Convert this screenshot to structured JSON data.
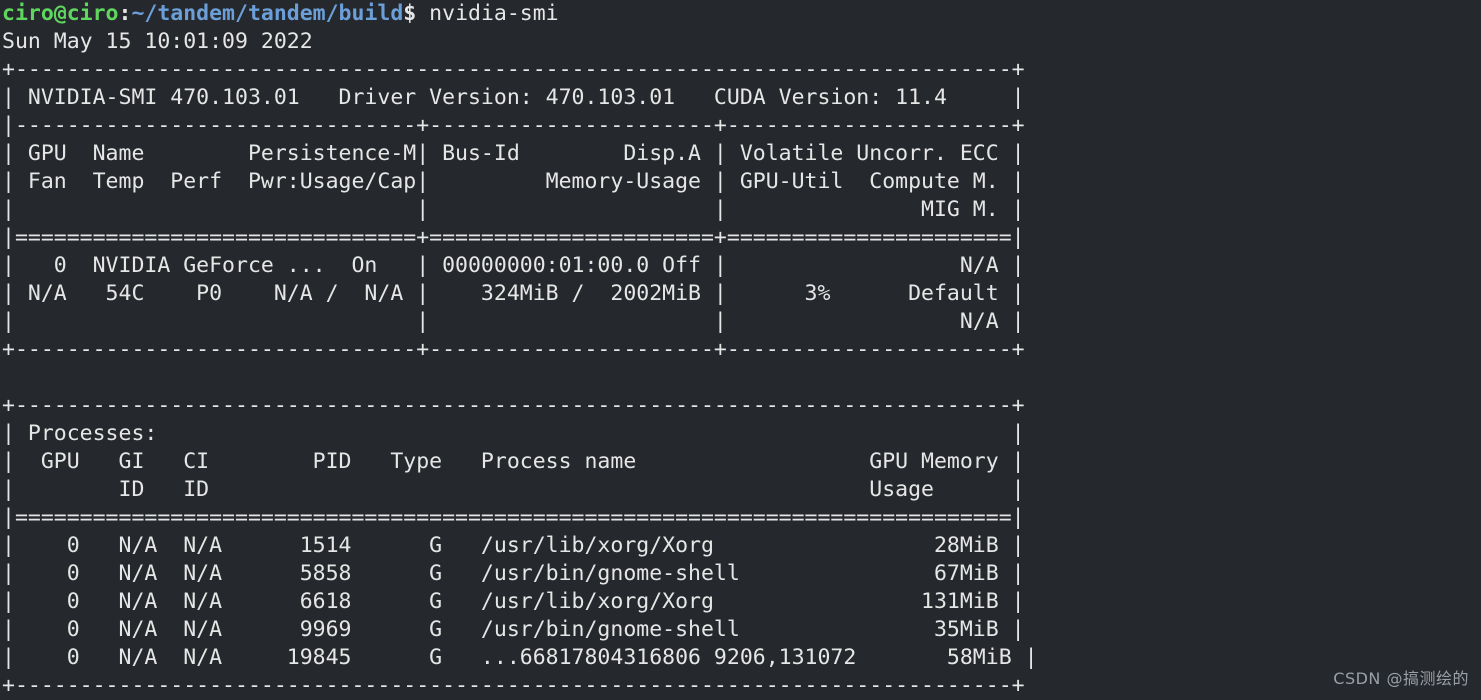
{
  "terminal": {
    "background_color": "#25282c",
    "foreground_color": "#e6e6e6",
    "prompt": {
      "user_host": "ciro@ciro",
      "separator": ":",
      "path": "~/tandem/tandem/build",
      "dollar": "$",
      "command": " nvidia-smi",
      "user_color": "#5fd75f",
      "path_color": "#6c9fd8"
    },
    "timestamp_line": "Sun May 15 10:01:09 2022",
    "gpu_table": {
      "top_border": "+-----------------------------------------------------------------------------+",
      "title_row": "| NVIDIA-SMI 470.103.01   Driver Version: 470.103.01   CUDA Version: 11.4     |",
      "title_fields": {
        "nvidia_smi_version": "470.103.01",
        "driver_version": "470.103.01",
        "cuda_version": "11.4"
      },
      "inner_border": "|-------------------------------+----------------------+----------------------+",
      "header_row_1": "| GPU  Name        Persistence-M| Bus-Id        Disp.A | Volatile Uncorr. ECC |",
      "header_row_2": "| Fan  Temp  Perf  Pwr:Usage/Cap|         Memory-Usage | GPU-Util  Compute M. |",
      "header_row_3": "|                               |                      |               MIG M. |",
      "header_separator": "|===============================+======================+======================|",
      "data_row_1": "|   0  NVIDIA GeForce ...  On   | 00000000:01:00.0 Off |                  N/A |",
      "data_row_2": "| N/A   54C    P0    N/A /  N/A |    324MiB /  2002MiB |      3%      Default |",
      "data_row_3": "|                               |                      |                  N/A |",
      "bottom_border": "+-------------------------------+----------------------+----------------------+",
      "gpu_values": {
        "gpu_index": "0",
        "name": "NVIDIA GeForce ...",
        "persistence_m": "On",
        "bus_id": "00000000:01:00.0",
        "disp_a": "Off",
        "ecc": "N/A",
        "fan": "N/A",
        "temp": "54C",
        "perf": "P0",
        "pwr_usage_cap": "N/A /  N/A",
        "memory_used": "324MiB",
        "memory_total": "2002MiB",
        "gpu_util": "3%",
        "compute_m": "Default",
        "mig_m": "N/A"
      }
    },
    "blank_line": "",
    "processes_table": {
      "top_border": "+-----------------------------------------------------------------------------+",
      "title_row": "| Processes:                                                                  |",
      "title": "Processes:",
      "header_row_1": "|  GPU   GI   CI        PID   Type   Process name                  GPU Memory |",
      "header_row_2": "|        ID   ID                                                   Usage      |",
      "header_separator": "|=============================================================================|",
      "columns": [
        "GPU",
        "GI ID",
        "CI ID",
        "PID",
        "Type",
        "Process name",
        "GPU Memory Usage"
      ],
      "rows": [
        {
          "line": "|    0   N/A  N/A      1514      G   /usr/lib/xorg/Xorg                 28MiB |",
          "gpu": "0",
          "gi_id": "N/A",
          "ci_id": "N/A",
          "pid": "1514",
          "type": "G",
          "process_name": "/usr/lib/xorg/Xorg",
          "gpu_memory": "28MiB"
        },
        {
          "line": "|    0   N/A  N/A      5858      G   /usr/bin/gnome-shell               67MiB |",
          "gpu": "0",
          "gi_id": "N/A",
          "ci_id": "N/A",
          "pid": "5858",
          "type": "G",
          "process_name": "/usr/bin/gnome-shell",
          "gpu_memory": "67MiB"
        },
        {
          "line": "|    0   N/A  N/A      6618      G   /usr/lib/xorg/Xorg                131MiB |",
          "gpu": "0",
          "gi_id": "N/A",
          "ci_id": "N/A",
          "pid": "6618",
          "type": "G",
          "process_name": "/usr/lib/xorg/Xorg",
          "gpu_memory": "131MiB"
        },
        {
          "line": "|    0   N/A  N/A      9969      G   /usr/bin/gnome-shell               35MiB |",
          "gpu": "0",
          "gi_id": "N/A",
          "ci_id": "N/A",
          "pid": "9969",
          "type": "G",
          "process_name": "/usr/bin/gnome-shell",
          "gpu_memory": "35MiB"
        },
        {
          "line": "|    0   N/A  N/A     19845      G   ...66817804316806 9206,131072       58MiB |",
          "gpu": "0",
          "gi_id": "N/A",
          "ci_id": "N/A",
          "pid": "19845",
          "type": "G",
          "process_name": "...668178043168069206,131072",
          "gpu_memory": "58MiB"
        }
      ],
      "bottom_border": "+-----------------------------------------------------------------------------+"
    },
    "watermark": "CSDN @搞测绘的"
  }
}
